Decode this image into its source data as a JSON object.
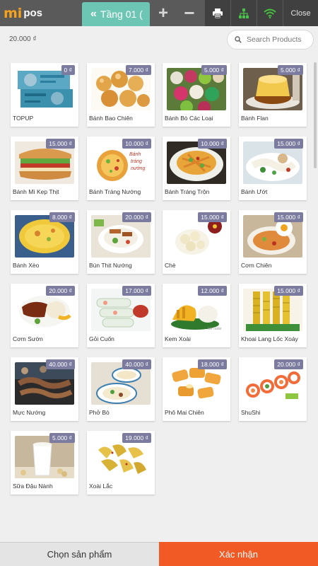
{
  "app": {
    "logo_mi": "mi",
    "logo_pos": "pos"
  },
  "header": {
    "floor_tab": "Tầng 01 (",
    "add_label": "+",
    "remove_label": "−",
    "close_label": "Close",
    "floor_tab_color": "#6cc6b3"
  },
  "summary": {
    "total": "20.000 ₫"
  },
  "search": {
    "placeholder": "Search Products",
    "value": ""
  },
  "products": [
    {
      "name": "TOPUP",
      "price": "0 ₫",
      "image": "banknote"
    },
    {
      "name": "Bánh Bao Chiên",
      "price": "7.000 ₫",
      "image": "fried-buns"
    },
    {
      "name": "Bánh Bò Các Loại",
      "price": "5.000 ₫",
      "image": "colorful-cakes"
    },
    {
      "name": "Bánh Flan",
      "price": "5.000 ₫",
      "image": "flan"
    },
    {
      "name": "Bánh Mì Kẹp Thịt",
      "price": "15.000 ₫",
      "image": "banh-mi"
    },
    {
      "name": "Bánh Tráng Nướng",
      "price": "10.000 ₫",
      "image": "grilled-rice-paper"
    },
    {
      "name": "Bánh Tráng Trộn",
      "price": "10.000 ₫",
      "image": "rice-paper-salad"
    },
    {
      "name": "Bánh Ướt",
      "price": "15.000 ₫",
      "image": "steamed-rolls"
    },
    {
      "name": "Bánh Xèo",
      "price": "8.000 ₫",
      "image": "pancake"
    },
    {
      "name": "Bún Thịt Nướng",
      "price": "20.000 ₫",
      "image": "noodle-bowl"
    },
    {
      "name": "Chè",
      "price": "15.000 ₫",
      "image": "sweet-soup"
    },
    {
      "name": "Cơm Chiên",
      "price": "15.000 ₫",
      "image": "fried-rice"
    },
    {
      "name": "Cơm Sườn",
      "price": "20.000 ₫",
      "image": "pork-rice"
    },
    {
      "name": "Gỏi Cuốn",
      "price": "17.000 ₫",
      "image": "spring-rolls"
    },
    {
      "name": "Kem Xoài",
      "price": "12.000 ₫",
      "image": "mango-dessert"
    },
    {
      "name": "Khoai Lang Lốc Xoáy",
      "price": "15.000 ₫",
      "image": "sweet-potato"
    },
    {
      "name": "Mực Nướng",
      "price": "40.000 ₫",
      "image": "grilled-squid"
    },
    {
      "name": "Phở Bò",
      "price": "40.000 ₫",
      "image": "pho"
    },
    {
      "name": "Phô Mai Chiên",
      "price": "18.000 ₫",
      "image": "fried-cheese"
    },
    {
      "name": "ShuShi",
      "price": "20.000 ₫",
      "image": "sushi"
    },
    {
      "name": "Sữa Đậu Nành",
      "price": "5.000 ₫",
      "image": "soy-milk"
    },
    {
      "name": "Xoài Lắc",
      "price": "19.000 ₫",
      "image": "shaken-mango"
    }
  ],
  "footer": {
    "choose_label": "Chọn sản phẩm",
    "confirm_label": "Xác nhận",
    "confirm_color": "#f15a24"
  },
  "colors": {
    "topbar": "#5a5a5a",
    "price_badge": "#7b7ba0",
    "wifi": "#44c23c"
  }
}
